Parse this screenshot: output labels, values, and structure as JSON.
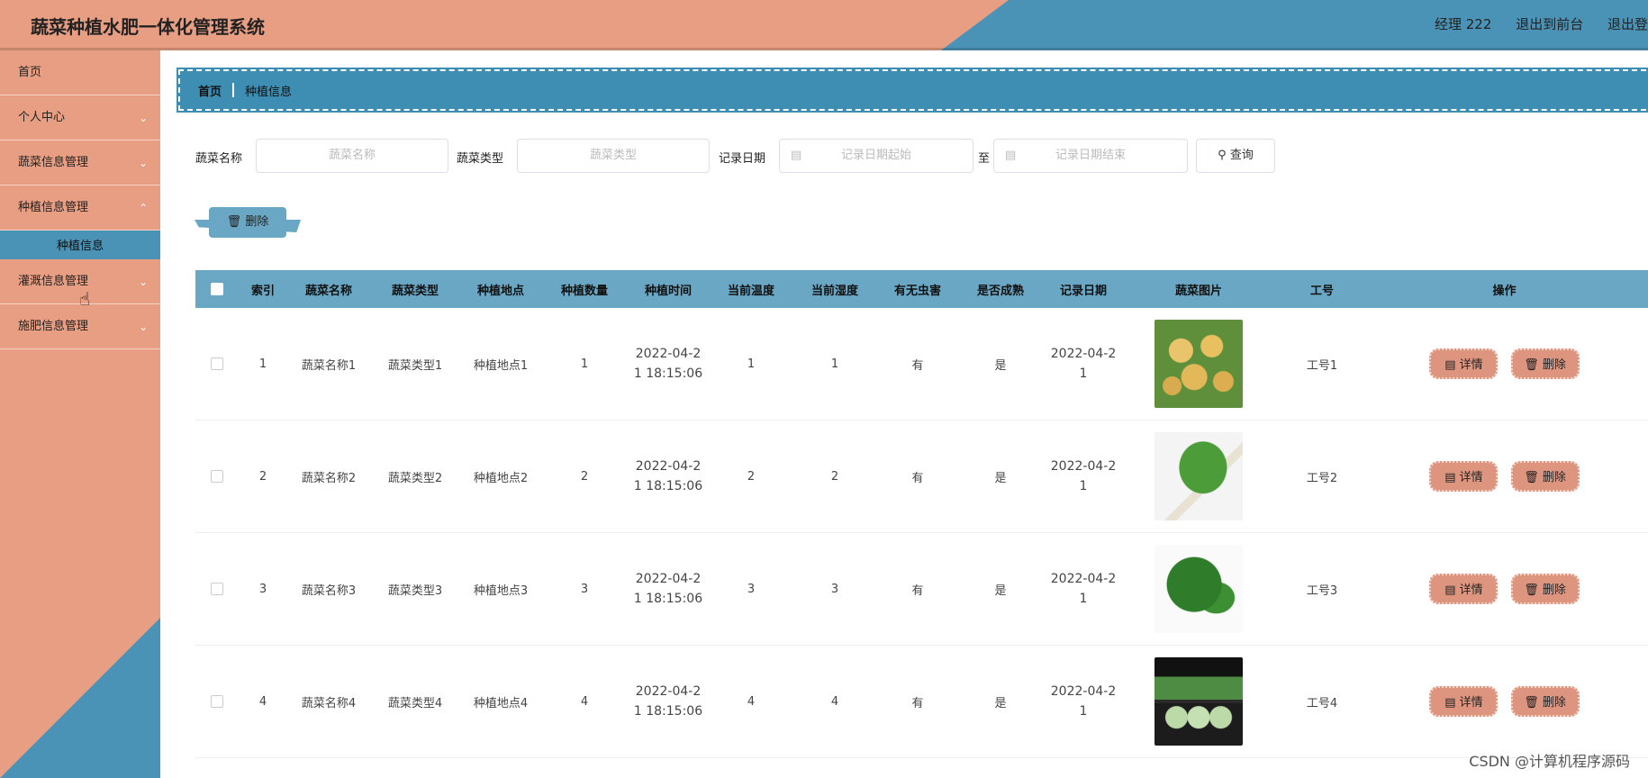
{
  "header": {
    "title": "蔬菜种植水肥一体化管理系统",
    "user": "经理 222",
    "back_front": "退出到前台",
    "logout": "退出登"
  },
  "sidebar": {
    "items": [
      {
        "label": "首页"
      },
      {
        "label": "个人中心"
      },
      {
        "label": "蔬菜信息管理"
      },
      {
        "label": "种植信息管理"
      },
      {
        "label": "灌溉信息管理"
      },
      {
        "label": "施肥信息管理"
      }
    ],
    "sub_item": "种植信息"
  },
  "breadcrumb": {
    "home": "首页",
    "current": "种植信息"
  },
  "search": {
    "name_label": "蔬菜名称",
    "name_placeholder": "蔬菜名称",
    "type_label": "蔬菜类型",
    "type_placeholder": "蔬菜类型",
    "date_label": "记录日期",
    "date_start_placeholder": "记录日期起始",
    "to_label": "至",
    "date_end_placeholder": "记录日期结束",
    "query_label": "查询"
  },
  "toolbar": {
    "delete_label": "删除"
  },
  "table": {
    "headers": [
      "索引",
      "蔬菜名称",
      "蔬菜类型",
      "种植地点",
      "种植数量",
      "种植时间",
      "当前温度",
      "当前湿度",
      "有无虫害",
      "是否成熟",
      "记录日期",
      "蔬菜图片",
      "工号",
      "操作"
    ],
    "rows": [
      {
        "idx": "1",
        "name": "蔬菜名称1",
        "type": "蔬菜类型1",
        "loc": "种植地点1",
        "num": "1",
        "time1": "2022-04-2",
        "time2": "1 18:15:06",
        "temp": "1",
        "hum": "1",
        "pest": "有",
        "ripe": "是",
        "date1": "2022-04-2",
        "date2": "1",
        "job": "工号1"
      },
      {
        "idx": "2",
        "name": "蔬菜名称2",
        "type": "蔬菜类型2",
        "loc": "种植地点2",
        "num": "2",
        "time1": "2022-04-2",
        "time2": "1 18:15:06",
        "temp": "2",
        "hum": "2",
        "pest": "有",
        "ripe": "是",
        "date1": "2022-04-2",
        "date2": "1",
        "job": "工号2"
      },
      {
        "idx": "3",
        "name": "蔬菜名称3",
        "type": "蔬菜类型3",
        "loc": "种植地点3",
        "num": "3",
        "time1": "2022-04-2",
        "time2": "1 18:15:06",
        "temp": "3",
        "hum": "3",
        "pest": "有",
        "ripe": "是",
        "date1": "2022-04-2",
        "date2": "1",
        "job": "工号3"
      },
      {
        "idx": "4",
        "name": "蔬菜名称4",
        "type": "蔬菜类型4",
        "loc": "种植地点4",
        "num": "4",
        "time1": "2022-04-2",
        "time2": "1 18:15:06",
        "temp": "4",
        "hum": "4",
        "pest": "有",
        "ripe": "是",
        "date1": "2022-04-2",
        "date2": "1",
        "job": "工号4"
      }
    ],
    "detail_label": "详情",
    "delete_label": "删除"
  },
  "watermark": "CSDN @计算机程序源码",
  "colors": {
    "salmon": "#e89e82",
    "blue": "#4a93b6",
    "table_head": "#6aa7c4",
    "op_button": "#dd9580"
  }
}
